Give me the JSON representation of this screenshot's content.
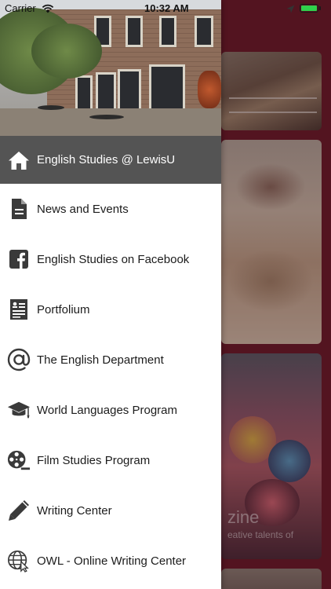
{
  "status_bar": {
    "carrier": "Carrier",
    "time": "10:32 AM",
    "battery_level": 1.0,
    "battery_color": "#2fd14b"
  },
  "drawer": {
    "active_color": "#545454",
    "items": [
      {
        "label": "English Studies @ LewisU",
        "icon": "home-icon",
        "active": true
      },
      {
        "label": "News and Events",
        "icon": "document-icon",
        "active": false
      },
      {
        "label": "English Studies on Facebook",
        "icon": "facebook-icon",
        "active": false
      },
      {
        "label": "Portfolium",
        "icon": "portfolio-icon",
        "active": false
      },
      {
        "label": "The English Department",
        "icon": "at-sign-icon",
        "active": false
      },
      {
        "label": "World Languages Program",
        "icon": "graduation-cap-icon",
        "active": false
      },
      {
        "label": "Film Studies Program",
        "icon": "film-reel-icon",
        "active": false
      },
      {
        "label": "Writing Center",
        "icon": "pencil-icon",
        "active": false
      },
      {
        "label": "OWL - Online Writing Center",
        "icon": "globe-cursor-icon",
        "active": false
      }
    ]
  },
  "background": {
    "accent": "#6a1b2a",
    "card_title_partial": "zine",
    "card_subtitle_partial": "eative talents of"
  }
}
